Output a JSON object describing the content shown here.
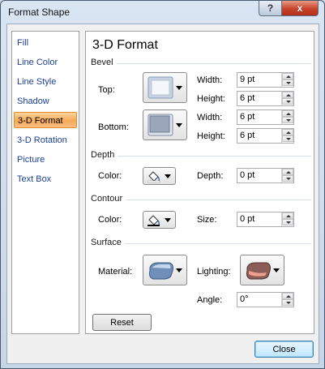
{
  "window": {
    "title": "Format Shape",
    "help_icon": "?",
    "close_icon": "x"
  },
  "nav": {
    "items": [
      {
        "label": "Fill"
      },
      {
        "label": "Line Color"
      },
      {
        "label": "Line Style"
      },
      {
        "label": "Shadow"
      },
      {
        "label": "3-D Format",
        "selected": true
      },
      {
        "label": "3-D Rotation"
      },
      {
        "label": "Picture"
      },
      {
        "label": "Text Box"
      }
    ]
  },
  "panel": {
    "title": "3-D Format",
    "bevel": {
      "heading": "Bevel",
      "top_label": "Top:",
      "bottom_label": "Bottom:",
      "top_width_label": "Width:",
      "top_width": "9 pt",
      "top_height_label": "Height:",
      "top_height": "6 pt",
      "bottom_width_label": "Width:",
      "bottom_width": "6 pt",
      "bottom_height_label": "Height:",
      "bottom_height": "6 pt"
    },
    "depth": {
      "heading": "Depth",
      "color_label": "Color:",
      "depth_label": "Depth:",
      "depth_value": "0 pt"
    },
    "contour": {
      "heading": "Contour",
      "color_label": "Color:",
      "size_label": "Size:",
      "size_value": "0 pt"
    },
    "surface": {
      "heading": "Surface",
      "material_label": "Material:",
      "lighting_label": "Lighting:",
      "angle_label": "Angle:",
      "angle_value": "0°"
    },
    "reset_label": "Reset"
  },
  "footer": {
    "close_label": "Close"
  },
  "colors": {
    "accent_orange": "#f6a857",
    "nav_text": "#1c3f94",
    "close_red": "#c8432a"
  }
}
